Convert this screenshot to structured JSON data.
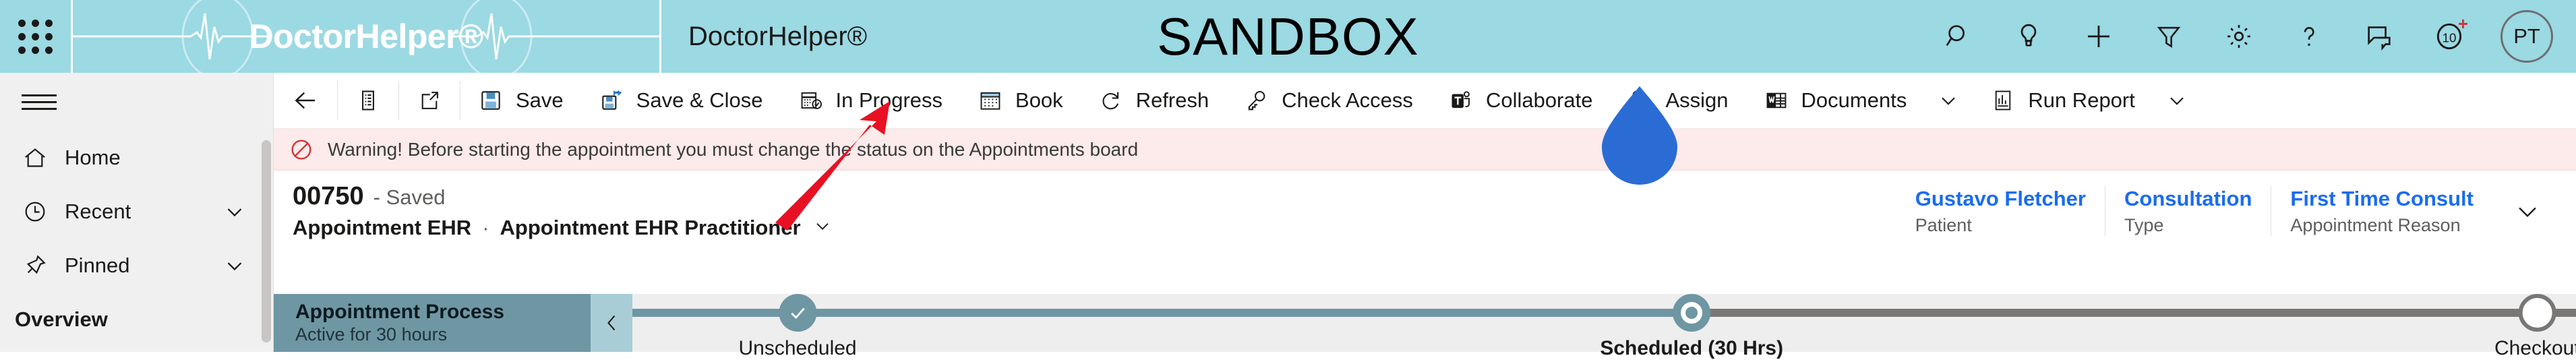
{
  "brand": {
    "waffle_icon": "app-launcher-waffle-icon",
    "logo_text": "DoctorHelper®",
    "app_title": "DoctorHelper®",
    "environment_banner": "SANDBOX",
    "bar_color": "#9BD9E3"
  },
  "topbar_actions": [
    {
      "name": "search-icon",
      "label": "Search"
    },
    {
      "name": "lightbulb-icon",
      "label": "Ideas"
    },
    {
      "name": "plus-icon",
      "label": "Quick Create"
    },
    {
      "name": "filter-icon",
      "label": "Filter"
    },
    {
      "name": "gear-icon",
      "label": "Settings"
    },
    {
      "name": "help-icon",
      "label": "Help"
    },
    {
      "name": "feedback-icon",
      "label": "Feedback"
    },
    {
      "name": "assistant-icon",
      "label": "10",
      "badge": "+"
    }
  ],
  "user": {
    "initials": "PT"
  },
  "sidebar": {
    "hamburger_label": "Expand navigation",
    "items": [
      {
        "label": "Home",
        "icon": "home-icon",
        "chevron": false
      },
      {
        "label": "Recent",
        "icon": "clock-icon",
        "chevron": true
      },
      {
        "label": "Pinned",
        "icon": "pin-icon",
        "chevron": true
      }
    ],
    "group_label": "Overview"
  },
  "commandbar": {
    "back": {
      "label": "Back",
      "icon": "arrow-left-icon"
    },
    "form_selector": {
      "label": "Show Chart",
      "icon": "form-icon"
    },
    "popout": {
      "label": "Open in new window",
      "icon": "popout-icon"
    },
    "buttons": [
      {
        "label": "Save",
        "icon": "save-icon"
      },
      {
        "label": "Save & Close",
        "icon": "save-close-icon"
      },
      {
        "label": "In Progress",
        "icon": "calendar-check-icon"
      },
      {
        "label": "Book",
        "icon": "calendar-icon"
      },
      {
        "label": "Refresh",
        "icon": "refresh-icon"
      },
      {
        "label": "Check Access",
        "icon": "key-icon"
      },
      {
        "label": "Collaborate",
        "icon": "teams-icon"
      },
      {
        "label": "Assign",
        "icon": "assign-user-icon"
      },
      {
        "label": "Documents",
        "icon": "word-doc-icon",
        "chevron": true
      },
      {
        "label": "Run Report",
        "icon": "report-icon",
        "chevron": true
      }
    ]
  },
  "warning": {
    "icon": "blocked-icon",
    "text": "Warning! Before starting the appointment you must change the status on the Appointments board",
    "bg_color": "#fdeaea",
    "icon_color": "#d13438"
  },
  "record_header": {
    "record_number": "00750",
    "save_state": "- Saved",
    "entity_name": "Appointment EHR",
    "separator": "·",
    "form_name": "Appointment EHR Practitioner",
    "fields": [
      {
        "value": "Gustavo Fletcher",
        "label": "Patient"
      },
      {
        "value": "Consultation",
        "label": "Type"
      },
      {
        "value": "First Time Consult",
        "label": "Appointment Reason"
      }
    ],
    "expand_chevron": "chevron-down-icon"
  },
  "process_flow": {
    "title": "Appointment Process",
    "subtitle": "Active for 30 hours",
    "prev_icon": "chevron-left-icon",
    "header_color": "#6e97a3",
    "stages": [
      {
        "label": "Unscheduled",
        "state": "complete",
        "position_pct": 8.5,
        "bold": false
      },
      {
        "label": "Scheduled  (30 Hrs)",
        "state": "active",
        "position_pct": 54.5,
        "bold": true
      },
      {
        "label": "Checkout",
        "state": "future",
        "position_pct": 98.0,
        "bold": false
      }
    ]
  },
  "annotations": {
    "pointer_color": "#2b6cd4",
    "arrow_color": "#e81123"
  }
}
